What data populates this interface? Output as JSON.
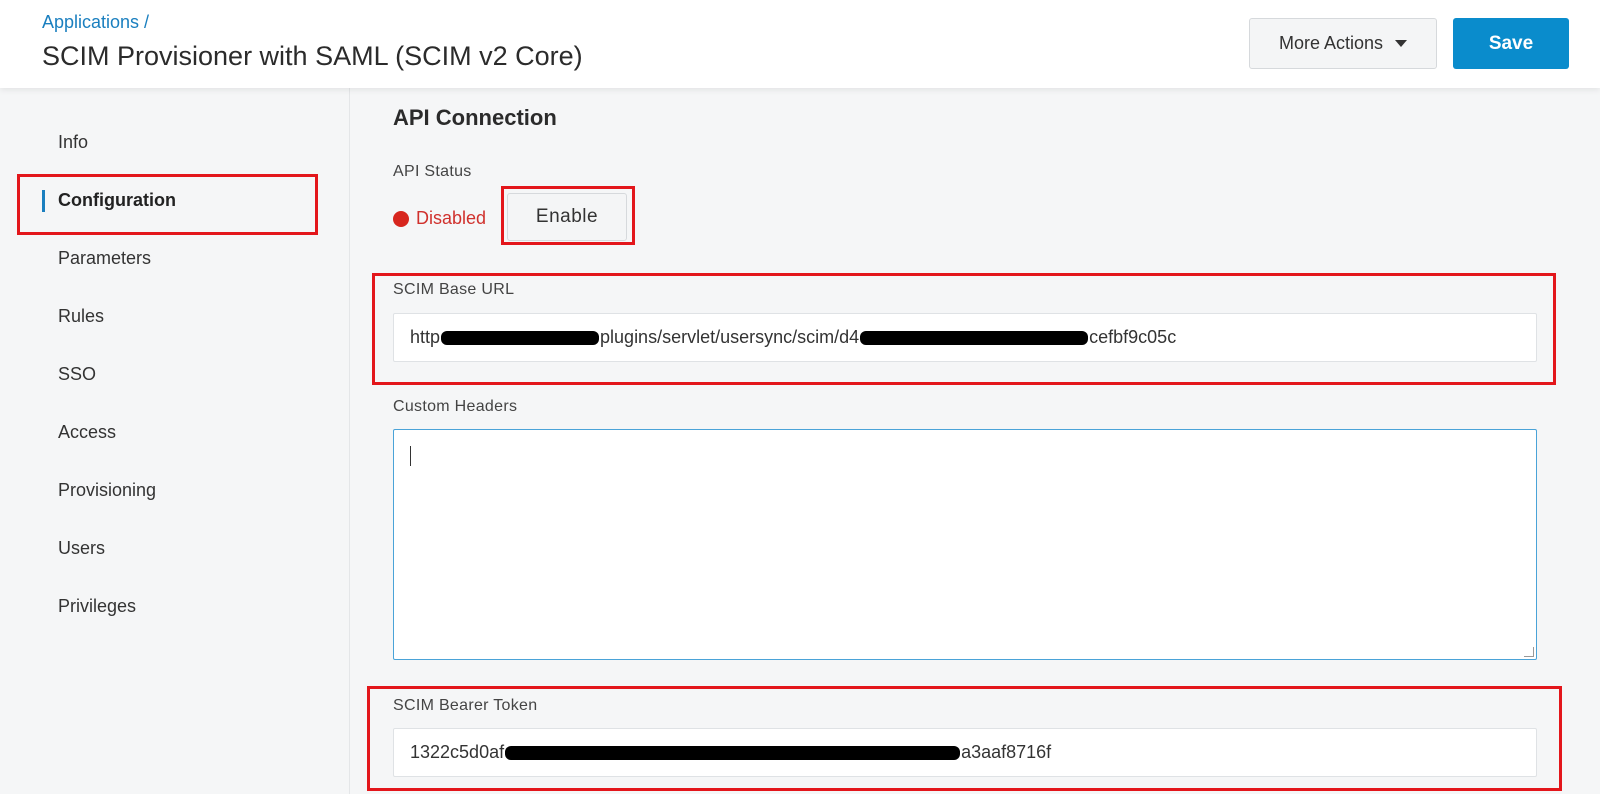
{
  "header": {
    "breadcrumb": "Applications /",
    "title": "SCIM Provisioner with SAML (SCIM v2 Core)",
    "more_actions_label": "More Actions",
    "save_label": "Save"
  },
  "sidebar": {
    "items": [
      {
        "label": "Info"
      },
      {
        "label": "Configuration",
        "active": true
      },
      {
        "label": "Parameters"
      },
      {
        "label": "Rules"
      },
      {
        "label": "SSO"
      },
      {
        "label": "Access"
      },
      {
        "label": "Provisioning"
      },
      {
        "label": "Users"
      },
      {
        "label": "Privileges"
      }
    ]
  },
  "main": {
    "section_title": "API Connection",
    "api_status": {
      "label": "API Status",
      "status_text": "Disabled",
      "status_color": "#d7261e",
      "enable_label": "Enable"
    },
    "scim_base_url": {
      "label": "SCIM Base URL",
      "value_prefix": "http",
      "value_mid": "plugins/servlet/usersync/scim/d4",
      "value_suffix": "cefbf9c05c"
    },
    "custom_headers": {
      "label": "Custom Headers",
      "value": ""
    },
    "scim_bearer_token": {
      "label": "SCIM Bearer Token",
      "value_prefix": "1322c5d0af",
      "value_suffix": "a3aaf8716f"
    }
  },
  "colors": {
    "accent": "#0a8ccc",
    "link": "#1a7fbf",
    "highlight": "#e3161b"
  }
}
